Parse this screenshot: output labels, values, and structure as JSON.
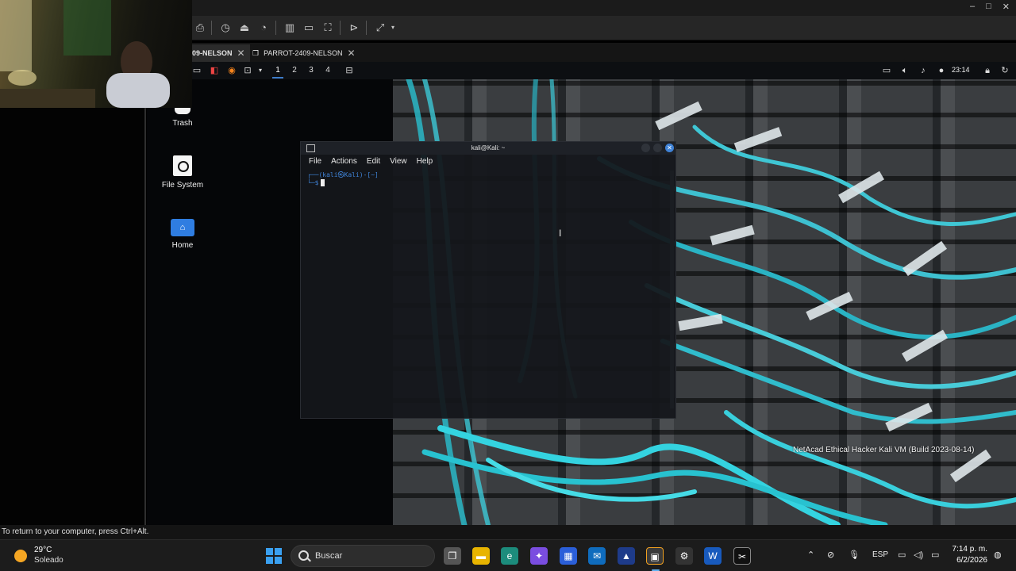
{
  "window": {
    "controls": [
      "–",
      "□",
      "✕"
    ]
  },
  "tabs": [
    {
      "label": "09-NELSON",
      "active": true
    },
    {
      "label": "PARROT-2409-NELSON",
      "active": false
    }
  ],
  "kali_panel": {
    "workspaces": [
      "1",
      "2",
      "3",
      "4"
    ],
    "active_workspace": "1",
    "clock": "23:14"
  },
  "desktop": {
    "icons": [
      {
        "label": "Trash",
        "icon": "trash-icon"
      },
      {
        "label": "File System",
        "icon": "drive-icon"
      },
      {
        "label": "Home",
        "icon": "home-folder-icon"
      }
    ],
    "watermark": "NetAcad Ethical Hacker Kali VM (Build 2023-08-14)"
  },
  "terminal": {
    "title": "kali@Kali: ~",
    "menu": [
      "File",
      "Actions",
      "Edit",
      "View",
      "Help"
    ],
    "prompt_line1": "┌──(kali㉿Kali)-[~]",
    "prompt_line2": "└─$"
  },
  "status_line": "To return to your computer, press Ctrl+Alt.",
  "taskbar": {
    "weather_temp": "29°C",
    "weather_desc": "Soleado",
    "search_placeholder": "Buscar",
    "language": "ESP",
    "time": "7:14 p. m.",
    "date": "6/2/2026",
    "accent": "#3aa0f0"
  }
}
